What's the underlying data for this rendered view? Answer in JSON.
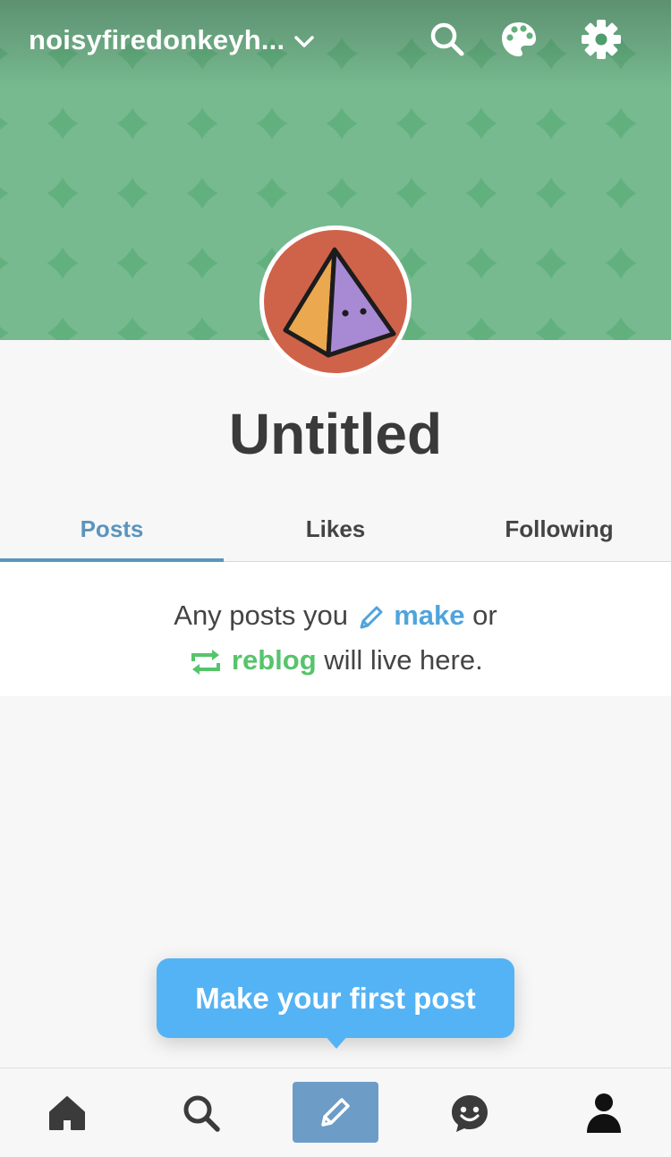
{
  "header": {
    "blog_name": "noisyfiredonkeyh...",
    "colors": {
      "background": "#63b07f",
      "avatar_bg": "#cf634a"
    },
    "icons": [
      "chevron-down-icon",
      "search-icon",
      "palette-icon",
      "gear-icon"
    ]
  },
  "profile": {
    "title": "Untitled"
  },
  "tabs": [
    {
      "label": "Posts",
      "active": true
    },
    {
      "label": "Likes",
      "active": false
    },
    {
      "label": "Following",
      "active": false
    }
  ],
  "empty_state": {
    "part1": "Any posts you",
    "make": "make",
    "part2": "or",
    "reblog": "reblog",
    "part3": "will live here."
  },
  "tooltip": {
    "text": "Make your first post"
  },
  "bottom_nav": {
    "items": [
      "home-icon",
      "search-icon",
      "compose-icon",
      "activity-icon",
      "account-icon"
    ],
    "accent": "#6d9cc7"
  }
}
